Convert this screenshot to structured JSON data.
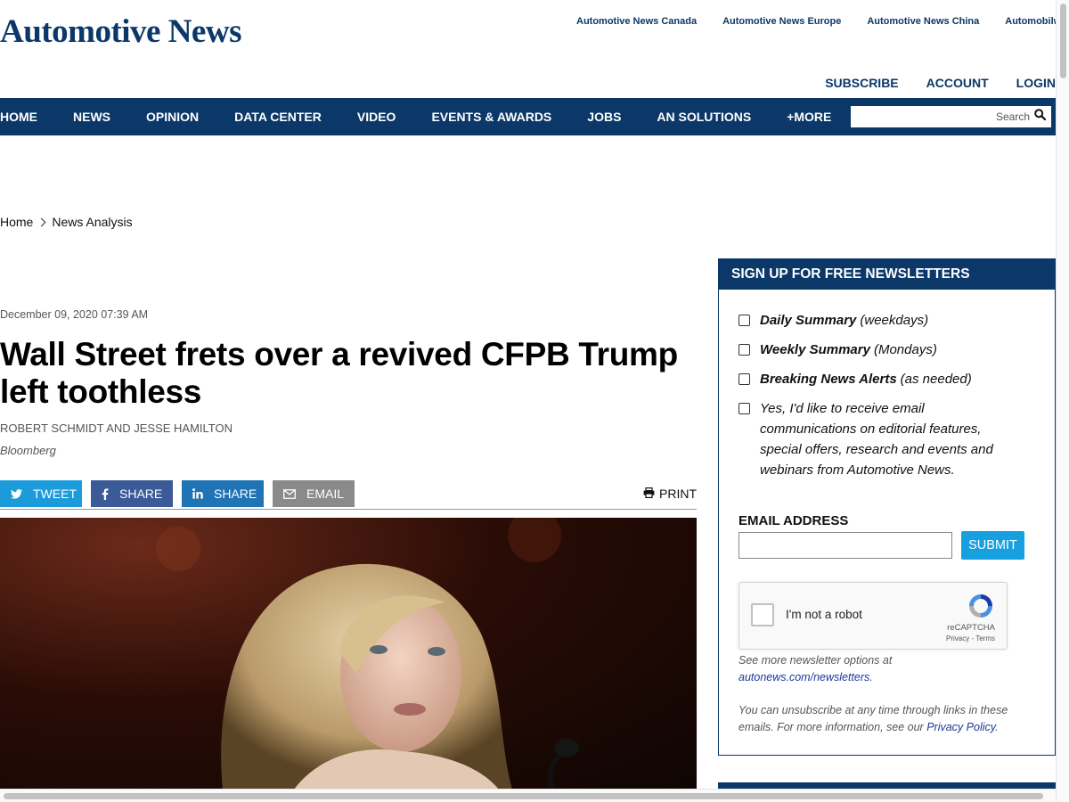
{
  "brand": {
    "logo_text": "Automotive News",
    "accent": "#0b3868",
    "submit_color": "#16a0e0"
  },
  "editions": [
    "Automotive News Canada",
    "Automotive News Europe",
    "Automotive News China",
    "Automobilwoche"
  ],
  "account_links": {
    "subscribe": "SUBSCRIBE",
    "account": "ACCOUNT",
    "login": "LOGIN"
  },
  "nav": {
    "items": [
      "HOME",
      "NEWS",
      "OPINION",
      "DATA CENTER",
      "VIDEO",
      "EVENTS & AWARDS",
      "JOBS",
      "AN SOLUTIONS",
      "+MORE"
    ],
    "search_placeholder": "Search",
    "search_icon": "search-icon"
  },
  "breadcrumb": {
    "home": "Home",
    "current": "News Analysis"
  },
  "article": {
    "date": "December 09, 2020 07:39 AM",
    "headline": "Wall Street frets over a revived CFPB Trump left toothless",
    "authors": "ROBERT SCHMIDT and JESSE HAMILTON",
    "source": "Bloomberg",
    "share": {
      "tweet": "TWEET",
      "facebook": "SHARE",
      "linkedin": "SHARE",
      "email": "EMAIL",
      "print": "PRINT"
    }
  },
  "newsletter": {
    "heading": "SIGN UP FOR FREE NEWSLETTERS",
    "options": [
      {
        "name": "Daily Summary",
        "frequency": "(weekdays)"
      },
      {
        "name": "Weekly Summary",
        "frequency": "(Mondays)"
      },
      {
        "name": "Breaking News Alerts",
        "frequency": "(as needed)"
      }
    ],
    "consent": "Yes, I'd like to receive email communications on editorial features, special offers, research and events and webinars from Automotive News.",
    "email_label": "EMAIL ADDRESS",
    "email_value": "",
    "submit": "SUBMIT",
    "recaptcha": {
      "label": "I'm not a robot",
      "brand": "reCAPTCHA",
      "terms": "Privacy - Terms"
    },
    "more_options_text": "See more newsletter options at",
    "more_options_link": "autonews.com/newsletters",
    "more_options_end": ".",
    "unsubscribe_text": "You can unsubscribe at any time through links in these emails. For more information, see our",
    "privacy_link": "Privacy Policy",
    "unsubscribe_end": "."
  }
}
